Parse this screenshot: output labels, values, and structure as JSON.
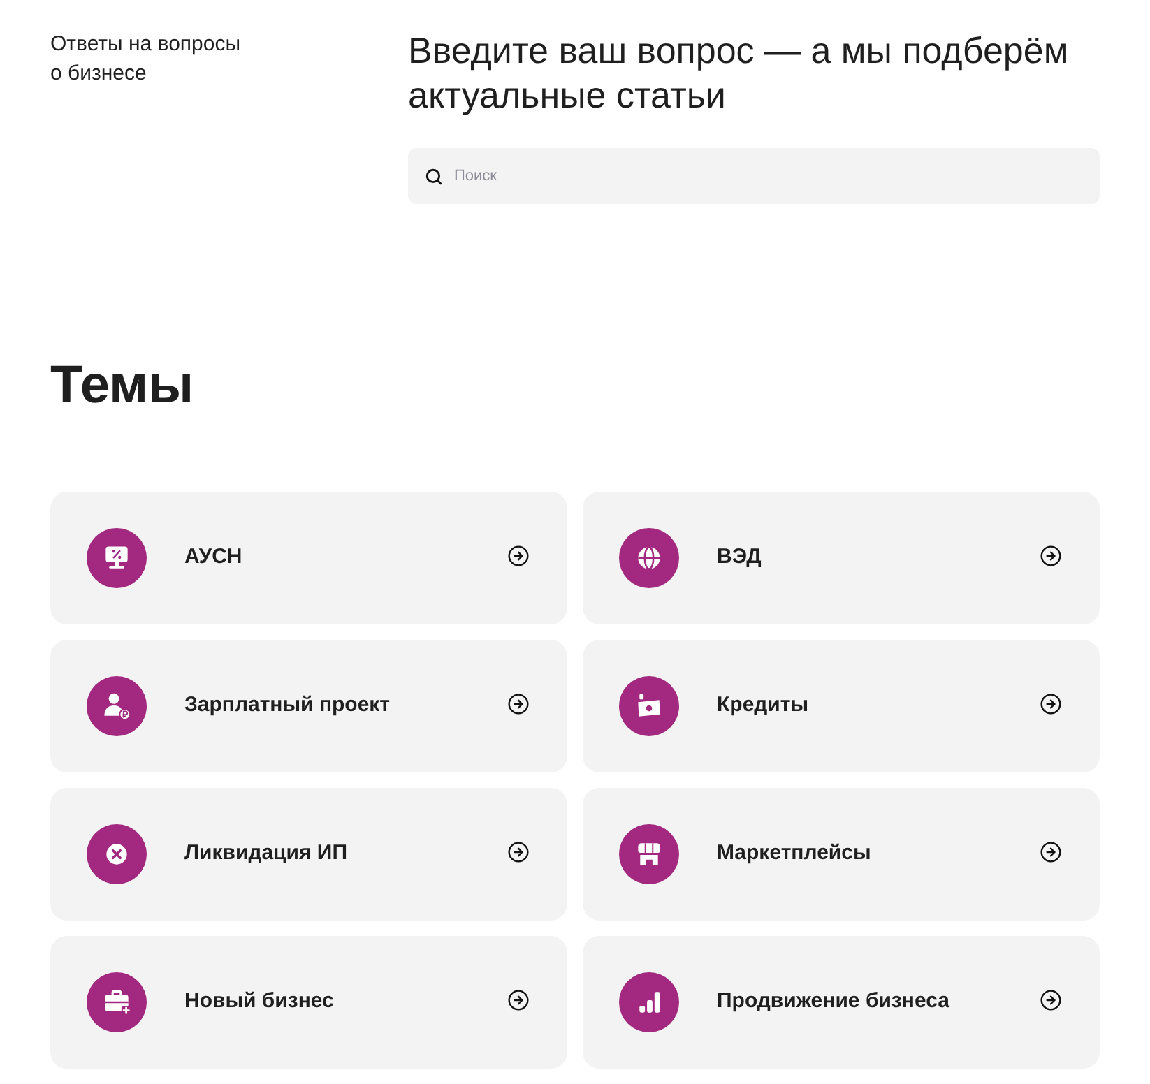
{
  "header": {
    "title": "Ответы на вопросы о бизнесе",
    "heading": "Введите ваш вопрос — а мы подберём актуальные статьи"
  },
  "search": {
    "placeholder": "Поиск"
  },
  "topics": {
    "title": "Темы",
    "items": [
      {
        "label": "АУСН"
      },
      {
        "label": "ВЭД"
      },
      {
        "label": "Зарплатный проект"
      },
      {
        "label": "Кредиты"
      },
      {
        "label": "Ликвидация ИП"
      },
      {
        "label": "Маркетплейсы"
      },
      {
        "label": "Новый бизнес"
      },
      {
        "label": "Продвижение бизнеса"
      }
    ]
  }
}
